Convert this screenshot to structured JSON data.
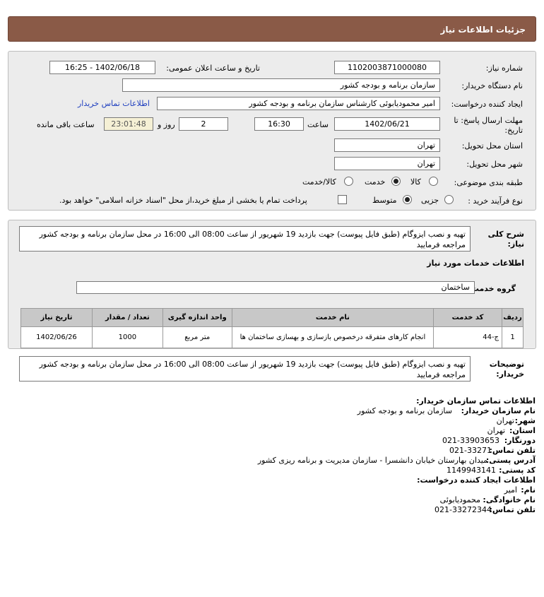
{
  "header": {
    "title": "جزئیات اطلاعات نیاز"
  },
  "form": {
    "need_number_label": "شماره نیاز:",
    "need_number": "1102003871000080",
    "announce_label": "تاریخ و ساعت اعلان عمومی:",
    "announce_value": "1402/06/18 - 16:25",
    "buyer_org_label": "نام دستگاه خریدار:",
    "buyer_org": "سازمان برنامه و بودجه کشور",
    "creator_label": "ایجاد کننده درخواست:",
    "creator": "امیر محمودیابوئی کارشناس سازمان برنامه و بودجه کشور",
    "buyer_contact_link": "اطلاعات تماس خریدار",
    "deadline_label_1": "مهلت ارسال پاسخ: تا",
    "deadline_label_2": "تاریخ:",
    "deadline_date": "1402/06/21",
    "time_label": "ساعت",
    "deadline_time": "16:30",
    "days_value": "2",
    "days_label": "روز و",
    "remaining_time": "23:01:48",
    "remaining_label": "ساعت باقی مانده",
    "province_label": "استان محل تحویل:",
    "province": "تهران",
    "city_label": "شهر محل تحویل:",
    "city": "تهران",
    "category_label": "طبقه بندی موضوعی:",
    "category_options": [
      "کالا",
      "خدمت",
      "کالا/خدمت"
    ],
    "purchase_type_label": "نوع فرآیند خرید :",
    "purchase_options": [
      "جزیی",
      "متوسط"
    ],
    "treasury_note": "پرداخت تمام یا بخشی از مبلغ خرید،از محل \"اسناد خزانه اسلامی\" خواهد بود."
  },
  "description": {
    "label_1": "شرح کلی",
    "label_2": "نیاز:",
    "text": "تهیه و نصب ایزوگام (طبق فایل پیوست) جهت بازدید 19 شهریور از ساعت 08:00 الی 16:00 در محل سازمان برنامه و بودجه کشور مراجعه فرمایید"
  },
  "services": {
    "section_title": "اطلاعات خدمات مورد نیاز",
    "group_label": "گروه خدمت:",
    "group_value": "ساختمان",
    "columns": [
      "ردیف",
      "کد خدمت",
      "نام خدمت",
      "واحد اندازه گیری",
      "تعداد / مقدار",
      "تاریخ نیاز"
    ],
    "rows": [
      {
        "index": "1",
        "code": "ج-44",
        "name": "انجام کارهای متفرقه درخصوص بازسازی و بهسازی ساختمان ها",
        "unit": "متر مربع",
        "qty": "1000",
        "date": "1402/06/26"
      }
    ]
  },
  "buyer_notes": {
    "label_1": "توضیحات",
    "label_2": "خریدار:",
    "text": "تهیه و نصب ایزوگام (طبق فایل پیوست) جهت بازدید 19 شهریور از ساعت 08:00 الی 16:00 در محل سازمان برنامه و بودجه کشور مراجعه فرمایید"
  },
  "contact": {
    "title": "اطلاعات تماس سازمان خریدار:",
    "org_label": "نام سازمان خریدار:",
    "org": "سازمان برنامه و بودجه کشور",
    "city_label": "شهر:",
    "city": "تهران",
    "province_label": "استان:",
    "province": "تهران",
    "fax_label": "دورنگار:",
    "fax": "021-33903653",
    "phone_label": "تلفن تماس:",
    "phone": "021-33271",
    "address_label": "آدرس پستی:",
    "address": "میدان بهارستان خیابان دانشسرا - سازمان مدیریت و برنامه ریزی کشور",
    "postal_label": "کد پستی:",
    "postal": "1149943141",
    "creator_title": "اطلاعات ایجاد کننده درخواست:",
    "name_label": "نام:",
    "name": "امیر",
    "family_label": "نام خانوادگی:",
    "family": "محمودیابوئی",
    "creator_phone_label": "تلفن تماس:",
    "creator_phone": "021-33272344"
  },
  "colors": {
    "header": "#8a5a47",
    "panel": "#ececec",
    "link": "#1f3fbf"
  }
}
